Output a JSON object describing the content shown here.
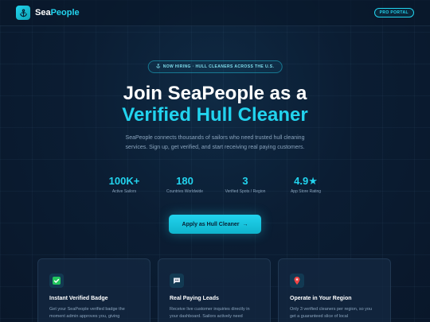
{
  "header": {
    "brand_prefix": "Sea",
    "brand_suffix": "People",
    "portal_label": "PRO PORTAL"
  },
  "hero": {
    "pill_text": "NOW HIRING · HULL CLEANERS ACROSS THE U.S.",
    "title_line1": "Join SeaPeople as a",
    "title_line2": "Verified Hull Cleaner",
    "subtitle": "SeaPeople connects thousands of sailors who need trusted hull cleaning services. Sign up, get verified, and start receiving real paying customers."
  },
  "stats": [
    {
      "value": "100K+",
      "label": "Active Sailors"
    },
    {
      "value": "180",
      "label": "Countries Worldwide"
    },
    {
      "value": "3",
      "label": "Verified Spots / Region"
    },
    {
      "value": "4.9★",
      "label": "App Store Rating"
    }
  ],
  "cta": {
    "label": "Apply as Hull Cleaner",
    "arrow": "→"
  },
  "cards": [
    {
      "icon": "check-icon",
      "title": "Instant Verified Badge",
      "text": "Get your SeaPeople verified badge the moment admin approves you, giving"
    },
    {
      "icon": "chat-icon",
      "title": "Real Paying Leads",
      "text": "Receive live customer inquiries directly in your dashboard. Sailors actively need"
    },
    {
      "icon": "pin-icon",
      "title": "Operate in Your Region",
      "text": "Only 3 verified cleaners per region, so you get a guaranteed slice of local"
    }
  ],
  "colors": {
    "accent": "#22d3ee",
    "background": "#0b1d33"
  }
}
